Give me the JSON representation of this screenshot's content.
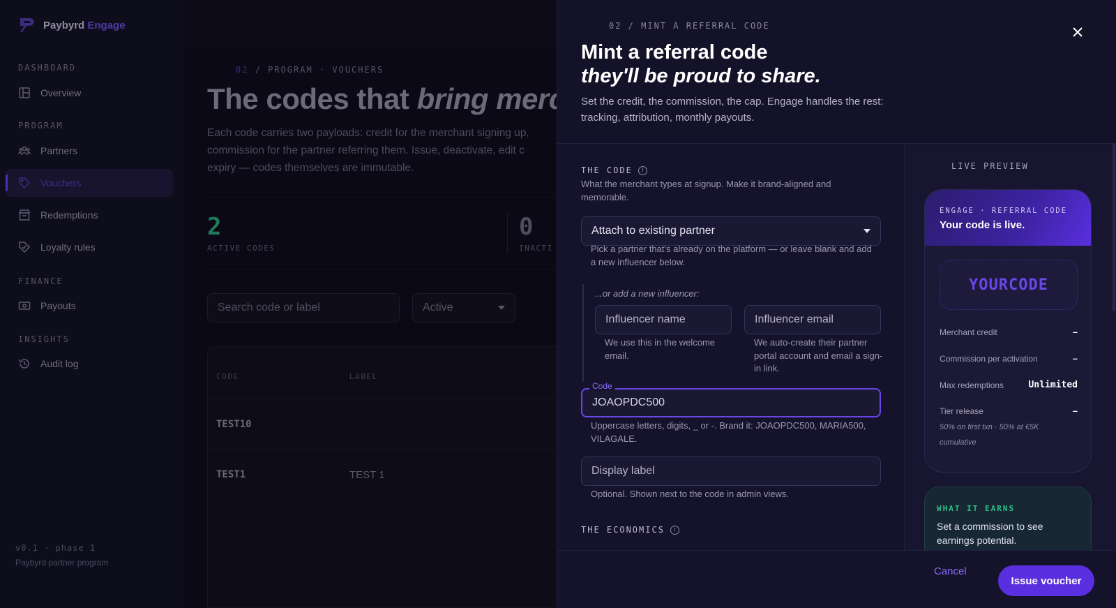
{
  "sidebar": {
    "brand": {
      "name": "Paybyrd",
      "accent": "Engage"
    },
    "sections": {
      "dashboard": "DASHBOARD",
      "program": "PROGRAM",
      "finance": "FINANCE",
      "insights": "INSIGHTS"
    },
    "items": {
      "overview": "Overview",
      "partners": "Partners",
      "vouchers": "Vouchers",
      "redemptions": "Redemptions",
      "loyalty": "Loyalty rules",
      "payouts": "Payouts",
      "audit": "Audit log"
    },
    "footer": {
      "version": "v0.1 · phase 1",
      "caption": "Paybyrd partner program"
    }
  },
  "main": {
    "breadcrumb": {
      "num": "02",
      "rest": "/ PROGRAM · VOUCHERS"
    },
    "hero": {
      "plain": "The codes that ",
      "emph": "bring merc"
    },
    "lede": [
      "Each code carries two payloads: credit for the merchant signing up,",
      "commission for the partner referring them. Issue, deactivate, edit c",
      "expiry — codes themselves are immutable."
    ],
    "stats": [
      {
        "value": "2",
        "label": "ACTIVE CODES",
        "color": "#1f7a59"
      },
      {
        "value": "0",
        "label": "INACTI",
        "color": "#4e4c5e"
      }
    ],
    "search_placeholder": "Search code or label",
    "filter_value": "Active",
    "table": {
      "headers": [
        "CODE",
        "LABEL"
      ],
      "rows": [
        {
          "code": "TEST10",
          "label": ""
        },
        {
          "code": "TEST1",
          "label": "TEST 1"
        }
      ]
    }
  },
  "panel": {
    "eyebrow": "02 / MINT A REFERRAL CODE",
    "title": "Mint a referral code",
    "title_em": "they'll be proud to share.",
    "subtitle": "Set the credit, the commission, the cap. Engage handles the rest: tracking, attribution, monthly payouts.",
    "code_section": {
      "heading": "THE CODE",
      "help": "What the merchant types at signup. Make it brand-aligned and memorable.",
      "partner_select": "Attach to existing partner",
      "partner_help": "Pick a partner that's already on the platform — or leave blank and add a new influencer below.",
      "group_label": "...or add a new influencer:",
      "name_placeholder": "Influencer name",
      "name_help": "We use this in the welcome email.",
      "email_placeholder": "Influencer email",
      "email_help": "We auto-create their partner portal account and email a sign-in link.",
      "code_label": "Code",
      "code_value": "JOAOPDC500",
      "code_help": "Uppercase letters, digits, _ or -. Brand it: JOAOPDC500, MARIA500, VILAGALE.",
      "display_placeholder": "Display label",
      "display_help": "Optional. Shown next to the code in admin views."
    },
    "economics_heading": "THE ECONOMICS",
    "preview": {
      "heading": "LIVE PREVIEW",
      "kicker": "ENGAGE · REFERRAL CODE",
      "live": "Your code is live.",
      "code": "YOURCODE",
      "rows": [
        {
          "label": "Merchant credit",
          "value": "–"
        },
        {
          "label": "Commission per activation",
          "value": "–"
        },
        {
          "label": "Max redemptions",
          "value": "Unlimited"
        },
        {
          "label": "Tier release",
          "value": "–"
        }
      ],
      "tier_note": "50% on first txn · 50% at €5K cumulative",
      "earn_heading": "WHAT IT EARNS",
      "earn_text": "Set a commission to see earnings potential."
    },
    "buttons": {
      "cancel": "Cancel",
      "issue": "Issue voucher"
    }
  },
  "colors": {
    "accent": "#5a2fe0",
    "accent_light": "#8b6cf7",
    "success": "#2fbf88",
    "background": "#0b0a16",
    "panel": "#15132b"
  }
}
